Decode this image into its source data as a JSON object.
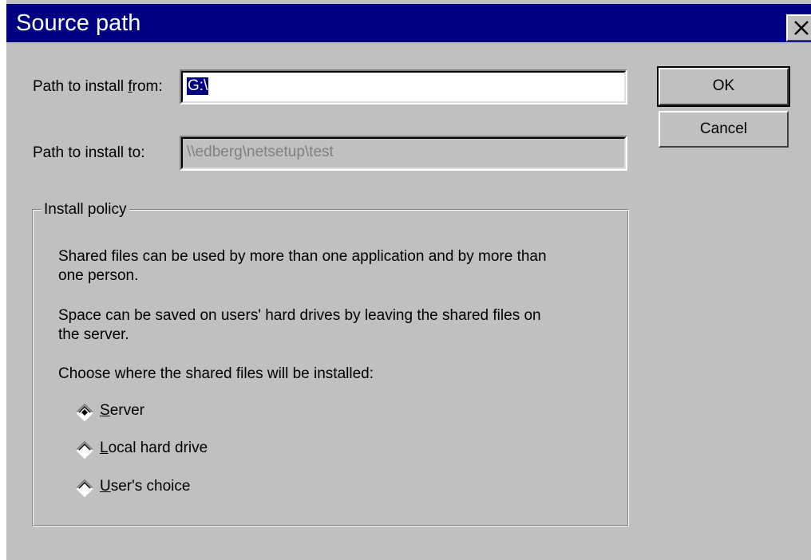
{
  "window": {
    "title": "Source path"
  },
  "fields": {
    "from_label_pre": "Path to install ",
    "from_label_accel": "f",
    "from_label_post": "rom:",
    "from_value": "G:\\",
    "to_label": "Path to install to:",
    "to_value": "\\\\edberg\\netsetup\\test"
  },
  "buttons": {
    "ok": "OK",
    "cancel": "Cancel"
  },
  "install_policy": {
    "legend": "Install policy",
    "para1_line1": "Shared files can be used by more than one application and by more than",
    "para1_line2": "one person.",
    "para2_line1": "Space can be saved on users' hard drives by leaving the shared files on",
    "para2_line2": "the server.",
    "prompt": "Choose where the shared files will be installed:",
    "options": [
      {
        "accel": "S",
        "rest": "erver",
        "selected": true
      },
      {
        "accel": "L",
        "rest": "ocal hard drive",
        "selected": false
      },
      {
        "accel": "U",
        "rest": "ser's choice",
        "selected": false
      }
    ]
  },
  "colors": {
    "titlebar": "#000080",
    "face": "#c0c0c0",
    "selection": "#000080"
  }
}
